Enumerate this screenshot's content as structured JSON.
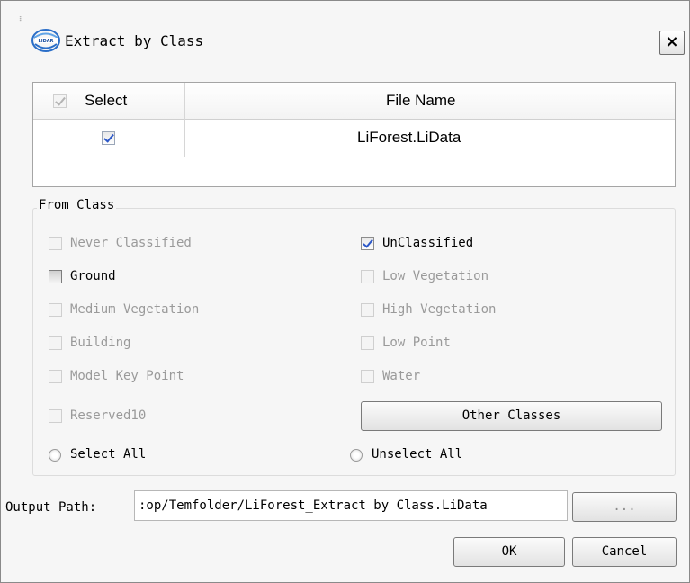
{
  "dialog": {
    "title": "Extract by Class",
    "close_glyph": "×",
    "icon": "lidar-logo-icon"
  },
  "file_table": {
    "headers": {
      "select": "Select",
      "file_name": "File Name"
    },
    "header_checkbox_checked": true,
    "rows": [
      {
        "selected": true,
        "file_name": "LiForest.LiData"
      }
    ]
  },
  "from_class": {
    "title": "From Class",
    "left": [
      {
        "label": "Never Classified",
        "checked": false,
        "enabled": false
      },
      {
        "label": "Ground",
        "checked": false,
        "enabled": true
      },
      {
        "label": "Medium Vegetation",
        "checked": false,
        "enabled": false
      },
      {
        "label": "Building",
        "checked": false,
        "enabled": false
      },
      {
        "label": "Model Key Point",
        "checked": false,
        "enabled": false
      },
      {
        "label": "Reserved10",
        "checked": false,
        "enabled": false
      }
    ],
    "right": [
      {
        "label": "UnClassified",
        "checked": true,
        "enabled": true
      },
      {
        "label": "Low Vegetation",
        "checked": false,
        "enabled": false
      },
      {
        "label": "High Vegetation",
        "checked": false,
        "enabled": false
      },
      {
        "label": "Low Point",
        "checked": false,
        "enabled": false
      },
      {
        "label": "Water",
        "checked": false,
        "enabled": false
      }
    ],
    "other_classes_label": "Other Classes",
    "select_all_label": "Select All",
    "unselect_all_label": "Unselect All"
  },
  "output": {
    "label": "Output Path:",
    "value": ":op/Temfolder/LiForest_Extract by Class.LiData",
    "browse_label": "..."
  },
  "buttons": {
    "ok": "OK",
    "cancel": "Cancel"
  },
  "colors": {
    "check": "#2b57c8",
    "disabled_text": "#9a9a9a",
    "dialog_bg": "#f6f6f6"
  }
}
